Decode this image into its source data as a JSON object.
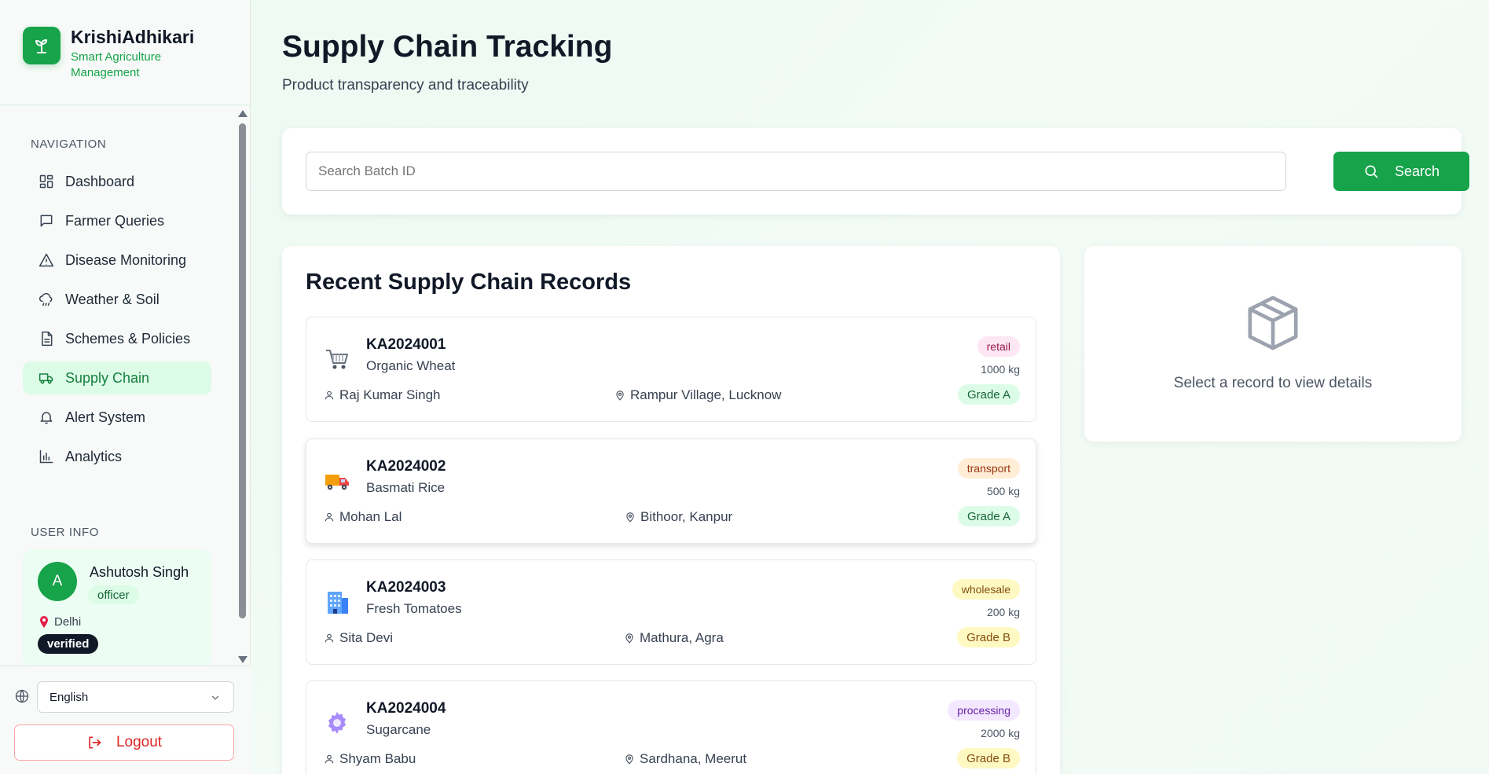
{
  "brand": {
    "title": "KrishiAdhikari",
    "subtitle": "Smart Agriculture Management"
  },
  "navigation": {
    "heading": "NAVIGATION",
    "items": [
      {
        "label": "Dashboard",
        "icon": "dashboard-icon",
        "active": false
      },
      {
        "label": "Farmer Queries",
        "icon": "message-icon",
        "active": false
      },
      {
        "label": "Disease Monitoring",
        "icon": "warning-icon",
        "active": false
      },
      {
        "label": "Weather & Soil",
        "icon": "cloud-rain-icon",
        "active": false
      },
      {
        "label": "Schemes & Policies",
        "icon": "document-icon",
        "active": false
      },
      {
        "label": "Supply Chain",
        "icon": "truck-icon",
        "active": true
      },
      {
        "label": "Alert System",
        "icon": "bell-icon",
        "active": false
      },
      {
        "label": "Analytics",
        "icon": "bar-chart-icon",
        "active": false
      }
    ]
  },
  "user_info": {
    "heading": "USER INFO",
    "initial": "A",
    "name": "Ashutosh Singh",
    "role": "officer",
    "location": "Delhi",
    "status": "verified"
  },
  "language": {
    "selected": "English"
  },
  "logout_label": "Logout",
  "page": {
    "title": "Supply Chain Tracking",
    "subtitle": "Product transparency and traceability"
  },
  "search": {
    "placeholder": "Search Batch ID",
    "value": "",
    "button_label": "Search"
  },
  "records": {
    "title": "Recent Supply Chain Records",
    "items": [
      {
        "batch_id": "KA2024001",
        "product": "Organic Wheat",
        "farmer": "Raj Kumar Singh",
        "location": "Rampur Village, Lucknow",
        "stage": "retail",
        "quantity": "1000 kg",
        "grade": "Grade A",
        "icon": "shopping-cart-icon"
      },
      {
        "batch_id": "KA2024002",
        "product": "Basmati Rice",
        "farmer": "Mohan Lal",
        "location": "Bithoor, Kanpur",
        "stage": "transport",
        "quantity": "500 kg",
        "grade": "Grade A",
        "icon": "delivery-truck-icon"
      },
      {
        "batch_id": "KA2024003",
        "product": "Fresh Tomatoes",
        "farmer": "Sita Devi",
        "location": "Mathura, Agra",
        "stage": "wholesale",
        "quantity": "200 kg",
        "grade": "Grade B",
        "icon": "office-building-icon"
      },
      {
        "batch_id": "KA2024004",
        "product": "Sugarcane",
        "farmer": "Shyam Babu",
        "location": "Sardhana, Meerut",
        "stage": "processing",
        "quantity": "2000 kg",
        "grade": "Grade B",
        "icon": "gear-icon"
      }
    ]
  },
  "details": {
    "empty_text": "Select a record to view details",
    "icon": "package-icon"
  },
  "colors": {
    "accent": "#16a34a",
    "active_nav_bg": "#dcfce7",
    "stage_retail": "#fce7f3",
    "stage_transport": "#ffedd5",
    "stage_wholesale": "#fef9c3",
    "stage_processing": "#f3e8ff",
    "grade_a": "#dcfce7",
    "grade_b": "#fef9c3",
    "danger": "#dc2626"
  }
}
